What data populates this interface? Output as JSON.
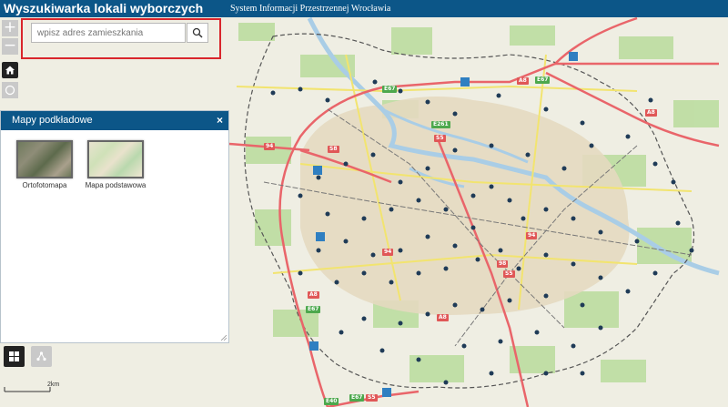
{
  "header": {
    "title": "Wyszukiwarka lokali wyborczych",
    "subtitle": "System Informacji Przestrzennej Wrocławia"
  },
  "search": {
    "placeholder": "wpisz adres zamieszkania",
    "icon": "search-icon"
  },
  "map_controls": {
    "zoom_in_label": "+",
    "zoom_out_label": "−",
    "home_icon": "home-icon",
    "locate_icon": "circle-locate-icon"
  },
  "basemap_panel": {
    "title": "Mapy podkładowe",
    "close_label": "×",
    "items": [
      {
        "label": "Ortofotomapa"
      },
      {
        "label": "Mapa podstawowa"
      }
    ]
  },
  "bottom_tools": {
    "basemap_icon": "grid-icon",
    "share_icon": "share-icon"
  },
  "scale_bar": {
    "label": "2km"
  },
  "road_labels": [
    "E67",
    "A8",
    "A8",
    "E67",
    "S5",
    "E261",
    "S8",
    "94",
    "A8",
    "94",
    "94",
    "98",
    "A8",
    "E67",
    "E40",
    "S5",
    "E67",
    "S5"
  ],
  "colors": {
    "header_bg": "#0c5688",
    "panel_header_bg": "#0c5688",
    "highlight_frame": "#d9262c",
    "road_main": "#e9656a",
    "road_secondary": "#f2e46f",
    "city_boundary": "#555555",
    "water": "#a9cde6",
    "green_area": "#a9d38d"
  }
}
